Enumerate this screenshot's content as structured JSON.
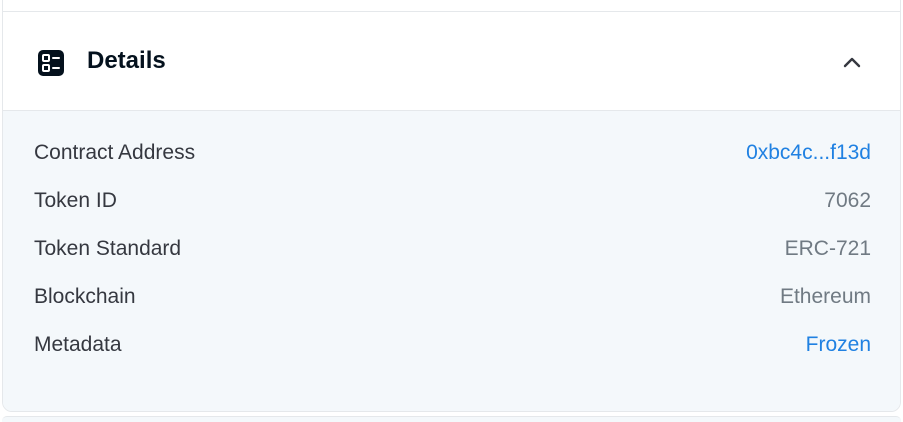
{
  "header": {
    "icon": "details-list-icon",
    "title": "Details",
    "toggle_icon": "chevron-up-icon"
  },
  "details": {
    "rows": [
      {
        "label": "Contract Address",
        "value": "0xbc4c...f13d",
        "type": "link"
      },
      {
        "label": "Token ID",
        "value": "7062",
        "type": "text"
      },
      {
        "label": "Token Standard",
        "value": "ERC-721",
        "type": "text"
      },
      {
        "label": "Blockchain",
        "value": "Ethereum",
        "type": "text"
      },
      {
        "label": "Metadata",
        "value": "Frozen",
        "type": "link"
      }
    ]
  },
  "colors": {
    "link": "#2081e2",
    "label": "#353840",
    "muted": "#707a83",
    "title": "#04111d",
    "body_bg": "#f4f8fb",
    "border": "#e5e8eb"
  }
}
